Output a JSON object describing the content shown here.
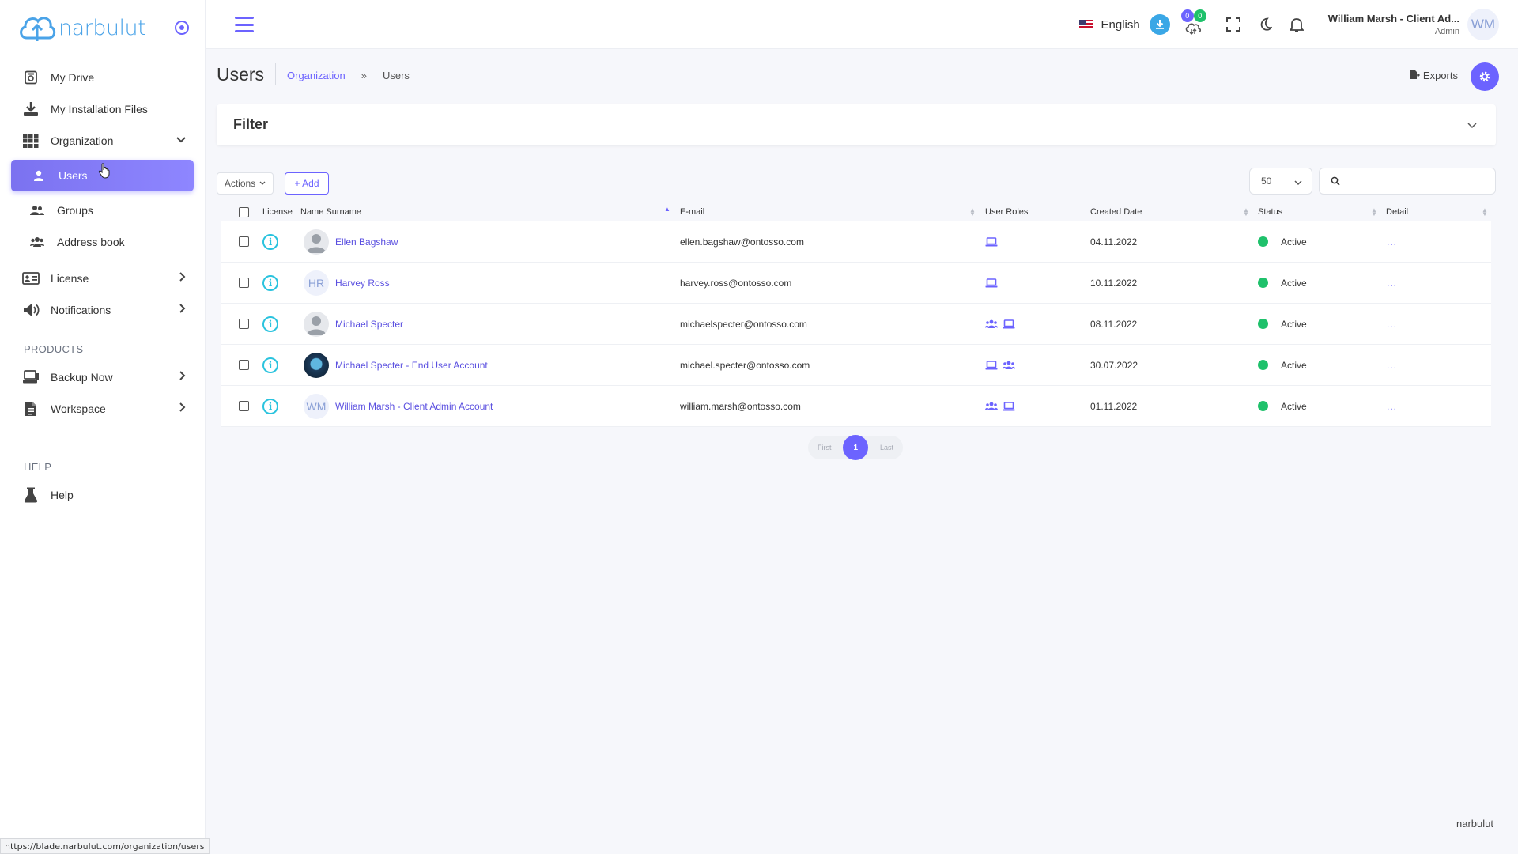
{
  "brand": {
    "name": "narbulut"
  },
  "sidebar": {
    "items": [
      {
        "label": "My Drive",
        "icon": "drive-icon"
      },
      {
        "label": "My Installation Files",
        "icon": "download-icon"
      },
      {
        "label": "Organization",
        "icon": "grid-icon"
      },
      {
        "label": "Users",
        "icon": "user-icon"
      },
      {
        "label": "Groups",
        "icon": "users-icon"
      },
      {
        "label": "Address book",
        "icon": "address-book-icon"
      },
      {
        "label": "License",
        "icon": "license-icon"
      },
      {
        "label": "Notifications",
        "icon": "megaphone-icon"
      }
    ],
    "products_heading": "PRODUCTS",
    "products": [
      {
        "label": "Backup Now",
        "icon": "computer-icon"
      },
      {
        "label": "Workspace",
        "icon": "document-icon"
      }
    ],
    "help_heading": "HELP",
    "help": [
      {
        "label": "Help",
        "icon": "flask-icon"
      }
    ]
  },
  "topbar": {
    "language": "English",
    "sync_badge_a": "0",
    "sync_badge_b": "0",
    "user_name": "William Marsh - Client Ad...",
    "user_role": "Admin",
    "user_initials": "WM"
  },
  "page": {
    "title": "Users",
    "breadcrumb_parent": "Organization",
    "breadcrumb_current": "Users",
    "exports_label": "Exports"
  },
  "filter": {
    "title": "Filter"
  },
  "toolbar": {
    "actions_label": "Actions",
    "add_label": "+ Add",
    "per_page": "50",
    "search_placeholder": ""
  },
  "table": {
    "columns": [
      "License",
      "Name Surname",
      "E-mail",
      "User Roles",
      "Created Date",
      "Status",
      "Detail"
    ],
    "rows": [
      {
        "name": "Ellen Bagshaw",
        "avatar": "photo",
        "initials": "",
        "email": "ellen.bagshaw@ontosso.com",
        "roles": [
          "laptop-icon"
        ],
        "created": "04.11.2022",
        "status": "Active",
        "detail": "..."
      },
      {
        "name": "Harvey Ross",
        "avatar": "initials",
        "initials": "HR",
        "email": "harvey.ross@ontosso.com",
        "roles": [
          "laptop-icon"
        ],
        "created": "10.11.2022",
        "status": "Active",
        "detail": "..."
      },
      {
        "name": "Michael Specter",
        "avatar": "photo",
        "initials": "",
        "email": "michaelspecter@ontosso.com",
        "roles": [
          "group-icon",
          "laptop-icon"
        ],
        "created": "08.11.2022",
        "status": "Active",
        "detail": "..."
      },
      {
        "name": "Michael Specter - End User Account",
        "avatar": "globe",
        "initials": "",
        "email": "michael.specter@ontosso.com",
        "roles": [
          "laptop-icon",
          "group-icon"
        ],
        "created": "30.07.2022",
        "status": "Active",
        "detail": "..."
      },
      {
        "name": "William Marsh - Client Admin Account",
        "avatar": "initials",
        "initials": "WM",
        "email": "william.marsh@ontosso.com",
        "roles": [
          "group-icon",
          "laptop-icon"
        ],
        "created": "01.11.2022",
        "status": "Active",
        "detail": "..."
      }
    ]
  },
  "pagination": {
    "first": "First",
    "current": "1",
    "last": "Last"
  },
  "footer": {
    "brand": "narbulut"
  },
  "status_url": "https://blade.narbulut.com/organization/users",
  "colors": {
    "accent": "#6c63ff",
    "active": "#1fc16b",
    "info": "#2ac3de",
    "brand": "#4aa3e8"
  }
}
